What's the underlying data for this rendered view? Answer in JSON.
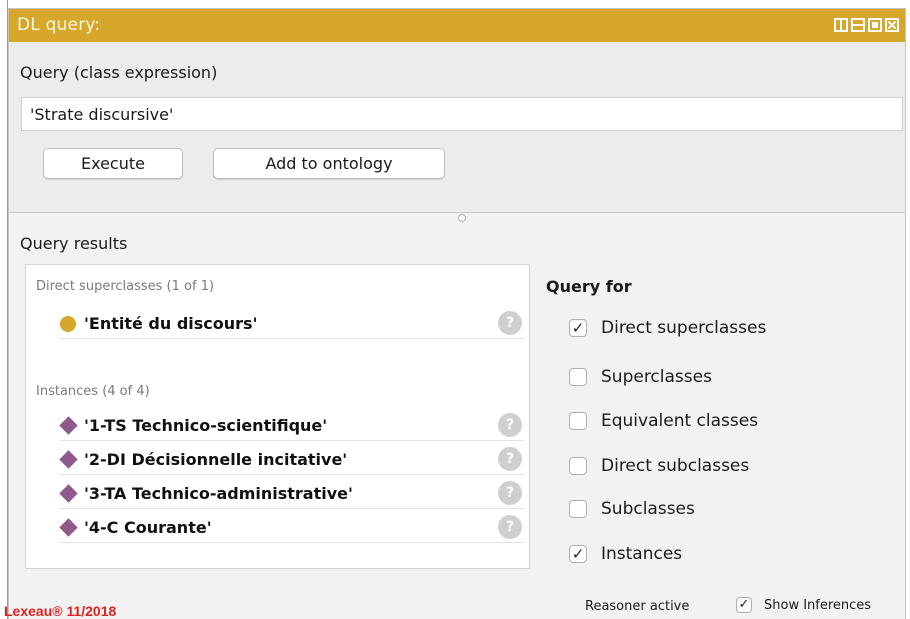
{
  "window": {
    "title": "DL query:",
    "title_bar_color": "#d7a72c"
  },
  "query": {
    "label": "Query (class expression)",
    "value": "'Strate discursive'"
  },
  "buttons": {
    "execute": "Execute",
    "add_to_ontology": "Add to ontology"
  },
  "results": {
    "label": "Query results",
    "groups": [
      {
        "label": "Direct superclasses (1 of 1)",
        "icon": "class-circle-icon",
        "items": [
          {
            "label": "'Entité du discours'",
            "help": "?"
          }
        ]
      },
      {
        "label": "Instances (4 of 4)",
        "icon": "individual-diamond-icon",
        "items": [
          {
            "label": "'1-TS Technico-scientifique'",
            "help": "?"
          },
          {
            "label": "'2-DI Décisionnelle incitative'",
            "help": "?"
          },
          {
            "label": "'3-TA Technico-administrative'",
            "help": "?"
          },
          {
            "label": "'4-C Courante'",
            "help": "?"
          }
        ]
      }
    ]
  },
  "query_for": {
    "title": "Query for",
    "options": [
      {
        "label": "Direct superclasses",
        "checked": true,
        "mark": "✓"
      },
      {
        "label": "Superclasses",
        "checked": false,
        "mark": ""
      },
      {
        "label": "Equivalent classes",
        "checked": false,
        "mark": ""
      },
      {
        "label": "Direct subclasses",
        "checked": false,
        "mark": ""
      },
      {
        "label": "Subclasses",
        "checked": false,
        "mark": ""
      },
      {
        "label": "Instances",
        "checked": true,
        "mark": "✓"
      }
    ]
  },
  "footer": {
    "watermark": "Lexeau® 11/2018",
    "reasoner_status": "Reasoner active",
    "show_inferences": {
      "label": "Show Inferences",
      "checked": true,
      "mark": "✓"
    }
  }
}
